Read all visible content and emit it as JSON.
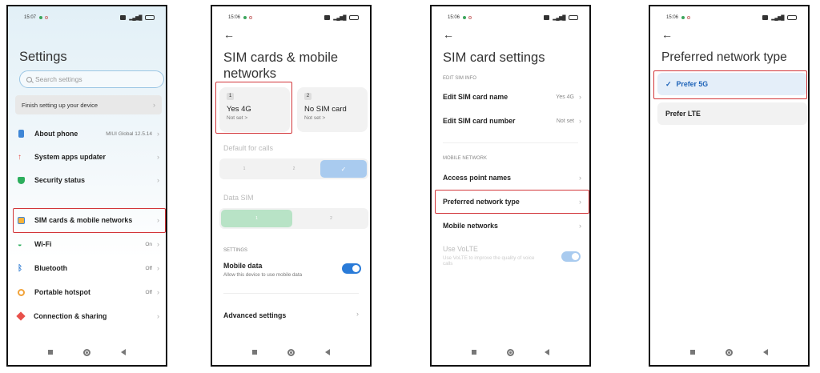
{
  "colors": {
    "accent": "#2a7bd8",
    "highlight": "#d2363a"
  },
  "phone1": {
    "status": {
      "time": "15:07"
    },
    "title": "Settings",
    "search_placeholder": "Search settings",
    "finish_setup": "Finish setting up your device",
    "items": [
      {
        "label": "About phone",
        "value": "MIUI Global 12.5.14",
        "icon": "phone-icon"
      },
      {
        "label": "System apps updater",
        "value": "",
        "icon": "arrow-up-icon"
      },
      {
        "label": "Security status",
        "value": "",
        "icon": "shield-check-icon"
      },
      {
        "label": "SIM cards & mobile networks",
        "value": "",
        "icon": "sim-icon"
      },
      {
        "label": "Wi-Fi",
        "value": "On",
        "icon": "wifi-icon"
      },
      {
        "label": "Bluetooth",
        "value": "Off",
        "icon": "bluetooth-icon"
      },
      {
        "label": "Portable hotspot",
        "value": "Off",
        "icon": "hotspot-icon"
      },
      {
        "label": "Connection & sharing",
        "value": "",
        "icon": "share-icon"
      }
    ]
  },
  "phone2": {
    "status": {
      "time": "15:06"
    },
    "title_line1": "SIM cards & mobile",
    "title_line2": "networks",
    "sim1": {
      "num": "1",
      "name": "Yes 4G",
      "sub": "Not set >"
    },
    "sim2": {
      "num": "2",
      "name": "No SIM card",
      "sub": "Not set >"
    },
    "default_calls_label": "Default for calls",
    "calls_options": [
      "1",
      "2",
      "✓"
    ],
    "data_sim_label": "Data SIM",
    "data_options": [
      "1",
      "2"
    ],
    "settings_label": "SETTINGS",
    "mobile_data_title": "Mobile data",
    "mobile_data_sub": "Allow this device to use mobile data",
    "advanced_settings": "Advanced settings"
  },
  "phone3": {
    "status": {
      "time": "15:06"
    },
    "title": "SIM card settings",
    "edit_section": "EDIT SIM INFO",
    "edit_name": "Edit SIM card name",
    "edit_name_value": "Yes 4G",
    "edit_number": "Edit SIM card number",
    "edit_number_value": "Not set",
    "mobile_section": "MOBILE NETWORK",
    "apn": "Access point names",
    "preferred": "Preferred network type",
    "mobile_networks": "Mobile networks",
    "volte_title": "Use VoLTE",
    "volte_sub_line1": "Use VoLTE to improve the quality of voice",
    "volte_sub_line2": "calls"
  },
  "phone4": {
    "status": {
      "time": "15:06"
    },
    "title": "Preferred network type",
    "options": [
      {
        "label": "Prefer 5G",
        "selected": true
      },
      {
        "label": "Prefer LTE",
        "selected": false
      }
    ]
  }
}
